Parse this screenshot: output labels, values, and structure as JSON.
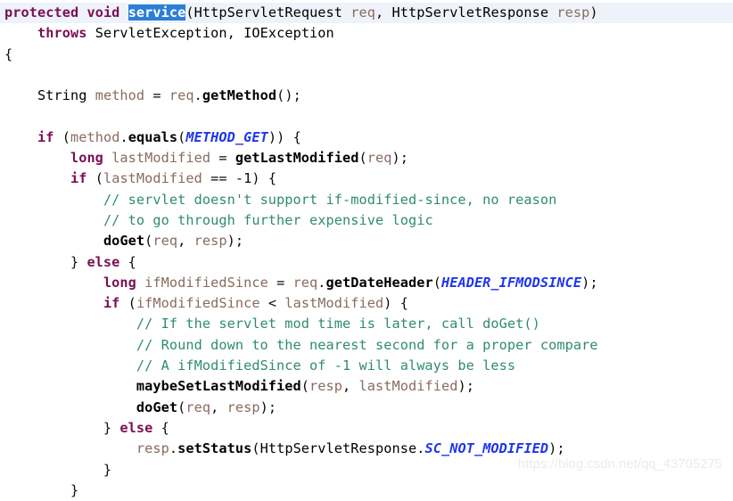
{
  "editor": {
    "language": "java",
    "background_color": "#ffffff",
    "current_line_highlight_color": "#eef2fb",
    "selection_background_color": "#2b7fd4",
    "selection_text_color": "#ffffff",
    "keyword_color": "#7a0f52",
    "comment_color": "#2e8b72",
    "static_field_color": "#1f36f0",
    "variable_color": "#8a6a5e",
    "plain_text_color": "#0b0b0b",
    "selected_token": "service"
  },
  "watermark": {
    "text": "https://blog.csdn.net/qq_43705275"
  },
  "code": {
    "lines": [
      {
        "index": 1,
        "current": true,
        "text": "protected void service(HttpServletRequest req, HttpServletResponse resp)",
        "tokens": [
          {
            "t": "protected",
            "c": "kw"
          },
          {
            "t": " ",
            "c": "plain"
          },
          {
            "t": "void",
            "c": "kw"
          },
          {
            "t": " ",
            "c": "plain"
          },
          {
            "t": "service",
            "c": "selected"
          },
          {
            "t": "(",
            "c": "punc"
          },
          {
            "t": "HttpServletRequest",
            "c": "type"
          },
          {
            "t": " ",
            "c": "plain"
          },
          {
            "t": "req",
            "c": "param"
          },
          {
            "t": ", ",
            "c": "punc"
          },
          {
            "t": "HttpServletResponse",
            "c": "type"
          },
          {
            "t": " ",
            "c": "plain"
          },
          {
            "t": "resp",
            "c": "param"
          },
          {
            "t": ")",
            "c": "punc"
          }
        ]
      },
      {
        "index": 2,
        "current": false,
        "text": "    throws ServletException, IOException",
        "tokens": [
          {
            "t": "    ",
            "c": "plain"
          },
          {
            "t": "throws",
            "c": "kw"
          },
          {
            "t": " ",
            "c": "plain"
          },
          {
            "t": "ServletException",
            "c": "type"
          },
          {
            "t": ", ",
            "c": "punc"
          },
          {
            "t": "IOException",
            "c": "type"
          }
        ]
      },
      {
        "index": 3,
        "current": false,
        "text": "{",
        "tokens": [
          {
            "t": "{",
            "c": "punc"
          }
        ]
      },
      {
        "index": 4,
        "current": false,
        "text": "",
        "tokens": []
      },
      {
        "index": 5,
        "current": false,
        "text": "    String method = req.getMethod();",
        "tokens": [
          {
            "t": "    ",
            "c": "plain"
          },
          {
            "t": "String",
            "c": "type"
          },
          {
            "t": " ",
            "c": "plain"
          },
          {
            "t": "method",
            "c": "var"
          },
          {
            "t": " = ",
            "c": "punc"
          },
          {
            "t": "req",
            "c": "param"
          },
          {
            "t": ".",
            "c": "punc"
          },
          {
            "t": "getMethod",
            "c": "method"
          },
          {
            "t": "();",
            "c": "punc"
          }
        ]
      },
      {
        "index": 6,
        "current": false,
        "text": "",
        "tokens": []
      },
      {
        "index": 7,
        "current": false,
        "text": "    if (method.equals(METHOD_GET)) {",
        "tokens": [
          {
            "t": "    ",
            "c": "plain"
          },
          {
            "t": "if",
            "c": "kw"
          },
          {
            "t": " (",
            "c": "punc"
          },
          {
            "t": "method",
            "c": "var"
          },
          {
            "t": ".",
            "c": "punc"
          },
          {
            "t": "equals",
            "c": "method"
          },
          {
            "t": "(",
            "c": "punc"
          },
          {
            "t": "METHOD_GET",
            "c": "static"
          },
          {
            "t": ")) {",
            "c": "punc"
          }
        ]
      },
      {
        "index": 8,
        "current": false,
        "text": "        long lastModified = getLastModified(req);",
        "tokens": [
          {
            "t": "        ",
            "c": "plain"
          },
          {
            "t": "long",
            "c": "kw"
          },
          {
            "t": " ",
            "c": "plain"
          },
          {
            "t": "lastModified",
            "c": "var"
          },
          {
            "t": " = ",
            "c": "punc"
          },
          {
            "t": "getLastModified",
            "c": "method"
          },
          {
            "t": "(",
            "c": "punc"
          },
          {
            "t": "req",
            "c": "param"
          },
          {
            "t": ");",
            "c": "punc"
          }
        ]
      },
      {
        "index": 9,
        "current": false,
        "text": "        if (lastModified == -1) {",
        "tokens": [
          {
            "t": "        ",
            "c": "plain"
          },
          {
            "t": "if",
            "c": "kw"
          },
          {
            "t": " (",
            "c": "punc"
          },
          {
            "t": "lastModified",
            "c": "var"
          },
          {
            "t": " == -1) {",
            "c": "punc"
          }
        ]
      },
      {
        "index": 10,
        "current": false,
        "text": "            // servlet doesn't support if-modified-since, no reason",
        "tokens": [
          {
            "t": "            ",
            "c": "plain"
          },
          {
            "t": "// servlet doesn't support if-modified-since, no reason",
            "c": "comment"
          }
        ]
      },
      {
        "index": 11,
        "current": false,
        "text": "            // to go through further expensive logic",
        "tokens": [
          {
            "t": "            ",
            "c": "plain"
          },
          {
            "t": "// to go through further expensive logic",
            "c": "comment"
          }
        ]
      },
      {
        "index": 12,
        "current": false,
        "text": "            doGet(req, resp);",
        "tokens": [
          {
            "t": "            ",
            "c": "plain"
          },
          {
            "t": "doGet",
            "c": "method"
          },
          {
            "t": "(",
            "c": "punc"
          },
          {
            "t": "req",
            "c": "param"
          },
          {
            "t": ", ",
            "c": "punc"
          },
          {
            "t": "resp",
            "c": "param"
          },
          {
            "t": ");",
            "c": "punc"
          }
        ]
      },
      {
        "index": 13,
        "current": false,
        "text": "        } else {",
        "tokens": [
          {
            "t": "        } ",
            "c": "punc"
          },
          {
            "t": "else",
            "c": "kw"
          },
          {
            "t": " {",
            "c": "punc"
          }
        ]
      },
      {
        "index": 14,
        "current": false,
        "text": "            long ifModifiedSince = req.getDateHeader(HEADER_IFMODSINCE);",
        "tokens": [
          {
            "t": "            ",
            "c": "plain"
          },
          {
            "t": "long",
            "c": "kw"
          },
          {
            "t": " ",
            "c": "plain"
          },
          {
            "t": "ifModifiedSince",
            "c": "var"
          },
          {
            "t": " = ",
            "c": "punc"
          },
          {
            "t": "req",
            "c": "param"
          },
          {
            "t": ".",
            "c": "punc"
          },
          {
            "t": "getDateHeader",
            "c": "method"
          },
          {
            "t": "(",
            "c": "punc"
          },
          {
            "t": "HEADER_IFMODSINCE",
            "c": "static"
          },
          {
            "t": ");",
            "c": "punc"
          }
        ]
      },
      {
        "index": 15,
        "current": false,
        "text": "            if (ifModifiedSince < lastModified) {",
        "tokens": [
          {
            "t": "            ",
            "c": "plain"
          },
          {
            "t": "if",
            "c": "kw"
          },
          {
            "t": " (",
            "c": "punc"
          },
          {
            "t": "ifModifiedSince",
            "c": "var"
          },
          {
            "t": " < ",
            "c": "punc"
          },
          {
            "t": "lastModified",
            "c": "var"
          },
          {
            "t": ") {",
            "c": "punc"
          }
        ]
      },
      {
        "index": 16,
        "current": false,
        "text": "                // If the servlet mod time is later, call doGet()",
        "tokens": [
          {
            "t": "                ",
            "c": "plain"
          },
          {
            "t": "// If the servlet mod time is later, call doGet()",
            "c": "comment"
          }
        ]
      },
      {
        "index": 17,
        "current": false,
        "text": "                // Round down to the nearest second for a proper compare",
        "tokens": [
          {
            "t": "                ",
            "c": "plain"
          },
          {
            "t": "// Round down to the nearest second for a proper compare",
            "c": "comment"
          }
        ]
      },
      {
        "index": 18,
        "current": false,
        "text": "                // A ifModifiedSince of -1 will always be less",
        "tokens": [
          {
            "t": "                ",
            "c": "plain"
          },
          {
            "t": "// A ifModifiedSince of -1 will always be less",
            "c": "comment"
          }
        ]
      },
      {
        "index": 19,
        "current": false,
        "text": "                maybeSetLastModified(resp, lastModified);",
        "tokens": [
          {
            "t": "                ",
            "c": "plain"
          },
          {
            "t": "maybeSetLastModified",
            "c": "method"
          },
          {
            "t": "(",
            "c": "punc"
          },
          {
            "t": "resp",
            "c": "param"
          },
          {
            "t": ", ",
            "c": "punc"
          },
          {
            "t": "lastModified",
            "c": "var"
          },
          {
            "t": ");",
            "c": "punc"
          }
        ]
      },
      {
        "index": 20,
        "current": false,
        "text": "                doGet(req, resp);",
        "tokens": [
          {
            "t": "                ",
            "c": "plain"
          },
          {
            "t": "doGet",
            "c": "method"
          },
          {
            "t": "(",
            "c": "punc"
          },
          {
            "t": "req",
            "c": "param"
          },
          {
            "t": ", ",
            "c": "punc"
          },
          {
            "t": "resp",
            "c": "param"
          },
          {
            "t": ");",
            "c": "punc"
          }
        ]
      },
      {
        "index": 21,
        "current": false,
        "text": "            } else {",
        "tokens": [
          {
            "t": "            } ",
            "c": "punc"
          },
          {
            "t": "else",
            "c": "kw"
          },
          {
            "t": " {",
            "c": "punc"
          }
        ]
      },
      {
        "index": 22,
        "current": false,
        "text": "                resp.setStatus(HttpServletResponse.SC_NOT_MODIFIED);",
        "tokens": [
          {
            "t": "                ",
            "c": "plain"
          },
          {
            "t": "resp",
            "c": "param"
          },
          {
            "t": ".",
            "c": "punc"
          },
          {
            "t": "setStatus",
            "c": "method"
          },
          {
            "t": "(",
            "c": "punc"
          },
          {
            "t": "HttpServletResponse",
            "c": "type"
          },
          {
            "t": ".",
            "c": "punc"
          },
          {
            "t": "SC_NOT_MODIFIED",
            "c": "static"
          },
          {
            "t": ");",
            "c": "punc"
          }
        ]
      },
      {
        "index": 23,
        "current": false,
        "text": "            }",
        "tokens": [
          {
            "t": "            }",
            "c": "punc"
          }
        ]
      },
      {
        "index": 24,
        "current": false,
        "text": "        }",
        "tokens": [
          {
            "t": "        }",
            "c": "punc"
          }
        ]
      }
    ]
  }
}
